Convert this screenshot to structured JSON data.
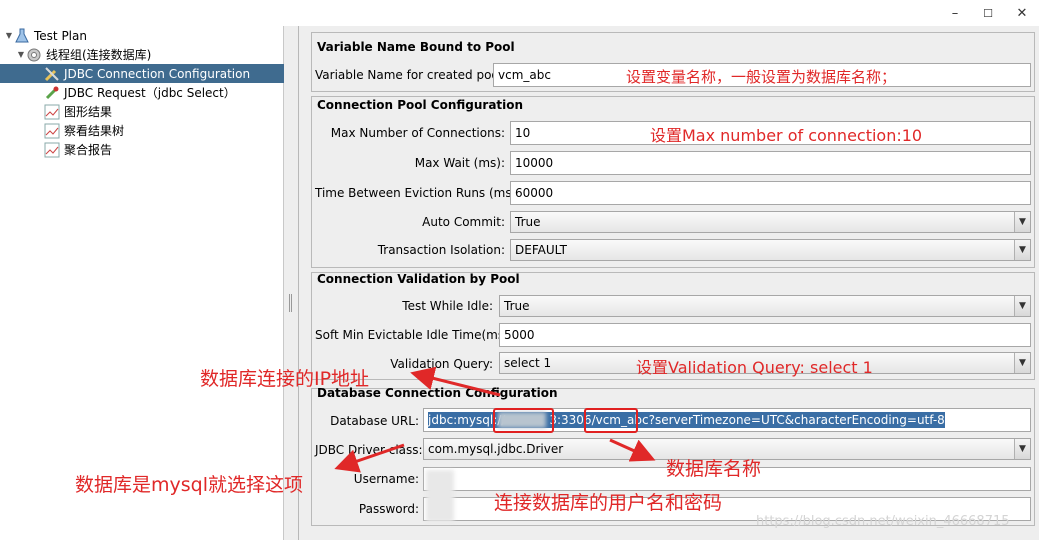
{
  "window": {
    "min": "–",
    "max": "☐",
    "close": "✕"
  },
  "tree": {
    "items": [
      {
        "label": "Test Plan",
        "icon": "beaker-icon",
        "toggle": "▼"
      },
      {
        "label": "线程组(连接数据库)",
        "icon": "gear-icon",
        "toggle": "▼"
      },
      {
        "label": "JDBC Connection Configuration",
        "icon": "wrench-icon",
        "selected": true
      },
      {
        "label": "JDBC Request（jdbc Select）",
        "icon": "pipette-icon"
      },
      {
        "label": "图形结果",
        "icon": "graph-icon"
      },
      {
        "label": "察看结果树",
        "icon": "graph-icon"
      },
      {
        "label": "聚合报告",
        "icon": "graph-icon"
      }
    ]
  },
  "sections": {
    "variable": {
      "title": "Variable Name Bound to Pool",
      "var_name_label": "Variable Name for created pool:",
      "var_name_value": "vcm_abc"
    },
    "pool": {
      "title": "Connection Pool Configuration",
      "max_conn_label": "Max Number of Connections:",
      "max_conn_value": "10",
      "max_wait_label": "Max Wait (ms):",
      "max_wait_value": "10000",
      "eviction_label": "Time Between Eviction Runs (ms):",
      "eviction_value": "60000",
      "auto_commit_label": "Auto Commit:",
      "auto_commit_value": "True",
      "isolation_label": "Transaction Isolation:",
      "isolation_value": "DEFAULT"
    },
    "validation": {
      "title": "Connection Validation by Pool",
      "test_idle_label": "Test While Idle:",
      "test_idle_value": "True",
      "soft_min_label": "Soft Min Evictable Idle Time(ms):",
      "soft_min_value": "5000",
      "query_label": "Validation Query:",
      "query_value": "select 1"
    },
    "db": {
      "title": "Database Connection Configuration",
      "url_label": "Database URL:",
      "url_part1": "jdbc:mysql://",
      "url_part2": "3",
      "url_part3": ":3306/",
      "url_part4": "vcm_abc",
      "url_part5": "?serverTimezone=UTC&characterEncoding=utf-8",
      "driver_label": "JDBC Driver class:",
      "driver_value": "com.mysql.jdbc.Driver",
      "username_label": "Username:",
      "password_label": "Password:"
    }
  },
  "annotations": {
    "var_name": "设置变量名称，一般设置为数据库名称；",
    "max_conn": "设置Max number of connection:10",
    "validation": "设置Validation Query: select 1",
    "ip": "数据库连接的IP地址",
    "driver": "数据库是mysql就选择这项",
    "db_name": "数据库名称",
    "credentials": "连接数据库的用户名和密码"
  },
  "watermark": "https://blog.csdn.net/weixin_46668715",
  "colors": {
    "selection": "#3f6b8f",
    "annotation": "#e02828"
  }
}
